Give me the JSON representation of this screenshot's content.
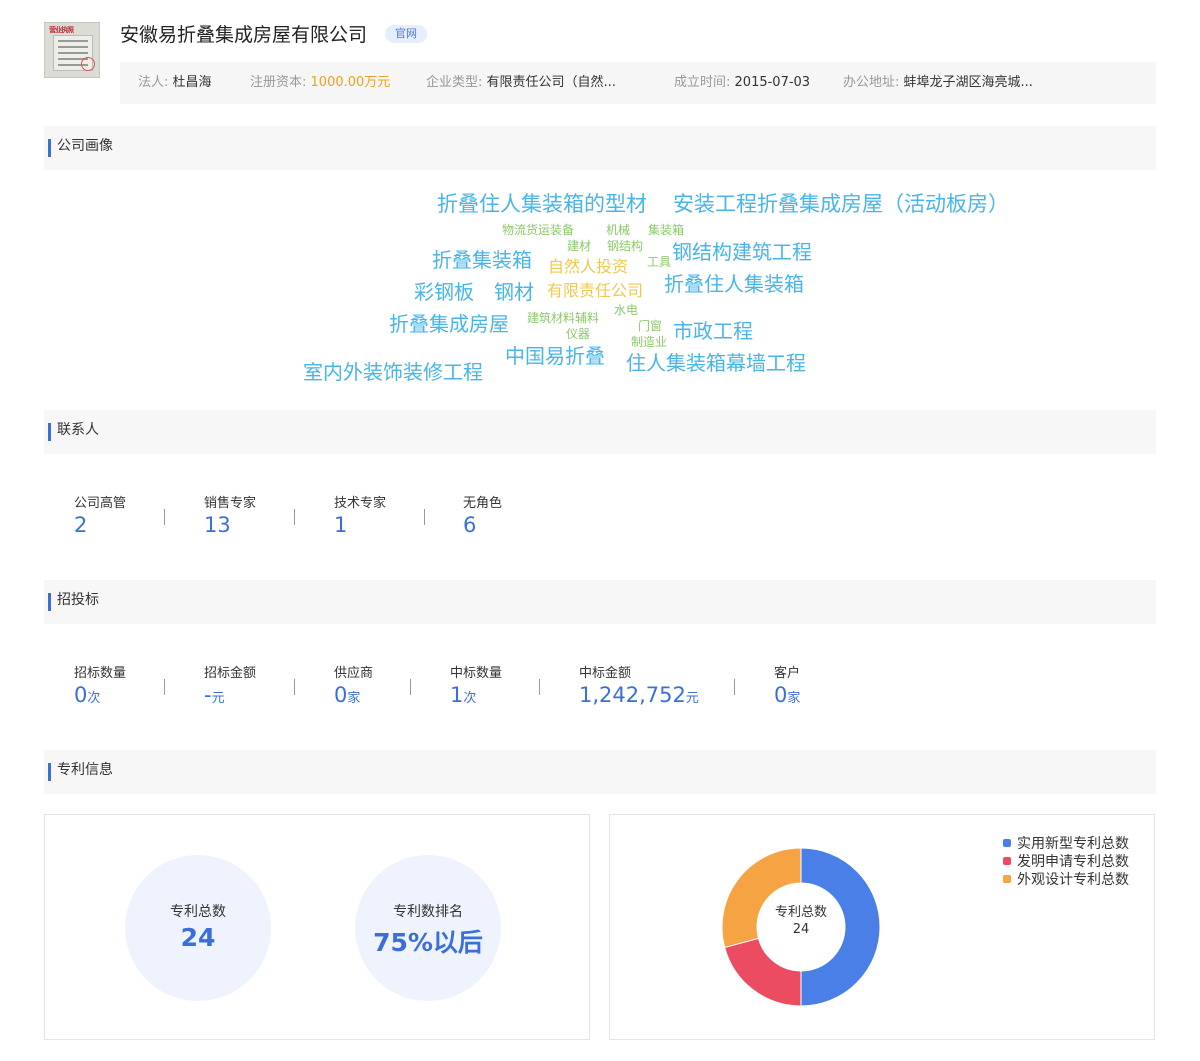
{
  "header": {
    "company_name": "安徽易折叠集成房屋有限公司",
    "official_badge": "官网",
    "logo_stamp_text": "营业执照",
    "info": {
      "legal_label": "法人:",
      "legal_value": "杜昌海",
      "capital_label": "注册资本:",
      "capital_value": "1000.00万元",
      "type_label": "企业类型:",
      "type_value": "有限责任公司（自然...",
      "founded_label": "成立时间:",
      "founded_value": "2015-07-03",
      "address_label": "办公地址:",
      "address_value": "蚌埠龙子湖区海亮城..."
    }
  },
  "sections": {
    "portrait": "公司画像",
    "contacts": "联系人",
    "bidding": "招投标",
    "patents": "专利信息"
  },
  "word_cloud": [
    "折叠住人集装箱的型材",
    "安装工程折叠集成房屋（活动板房）",
    "物流货运装备",
    "机械",
    "集装箱",
    "建材",
    "钢结构",
    "折叠集装箱",
    "钢结构建筑工程",
    "自然人投资",
    "工具",
    "折叠住人集装箱",
    "彩钢板",
    "钢材",
    "有限责任公司",
    "水电",
    "建筑材料辅料",
    "门窗",
    "折叠集成房屋",
    "仪器",
    "市政工程",
    "制造业",
    "中国易折叠",
    "住人集装箱幕墙工程",
    "室内外装饰装修工程"
  ],
  "contacts": [
    {
      "label": "公司高管",
      "value": "2"
    },
    {
      "label": "销售专家",
      "value": "13"
    },
    {
      "label": "技术专家",
      "value": "1"
    },
    {
      "label": "无角色",
      "value": "6"
    }
  ],
  "bidding": [
    {
      "label": "招标数量",
      "value": "0",
      "unit": "次"
    },
    {
      "label": "招标金额",
      "value": "-",
      "unit": "元"
    },
    {
      "label": "供应商",
      "value": "0",
      "unit": "家"
    },
    {
      "label": "中标数量",
      "value": "1",
      "unit": "次"
    },
    {
      "label": "中标金额",
      "value": "1,242,752",
      "unit": "元"
    },
    {
      "label": "客户",
      "value": "0",
      "unit": "家"
    }
  ],
  "patents": {
    "total_label": "专利总数",
    "total_value": "24",
    "rank_label": "专利数排名",
    "rank_value": "75%以后"
  },
  "chart_data": {
    "type": "pie",
    "center_label": "专利总数",
    "center_value": "24",
    "categories": [
      "实用新型专利总数",
      "发明申请专利总数",
      "外观设计专利总数"
    ],
    "values": [
      12,
      5,
      7
    ],
    "colors": [
      "#4a7fe8",
      "#ec4c62",
      "#f6a443"
    ],
    "legend": "top-right"
  }
}
